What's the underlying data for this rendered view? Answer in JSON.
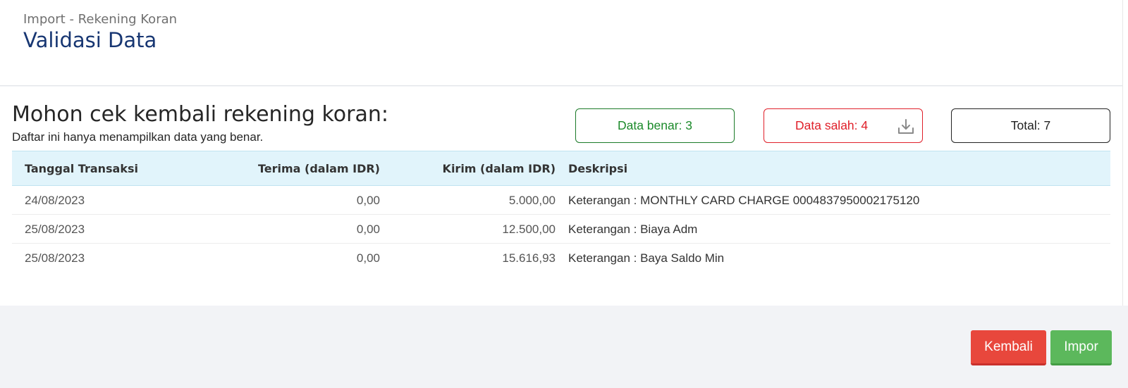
{
  "header": {
    "breadcrumb": "Import - Rekening Koran",
    "title": "Validasi Data"
  },
  "main": {
    "heading": "Mohon cek kembali rekening koran:",
    "subheading": "Daftar ini hanya menampilkan data yang benar.",
    "stats": {
      "benar": "Data benar: 3",
      "salah": "Data salah: 4",
      "total": "Total: 7"
    },
    "colors": {
      "benar": "#1b8a2a",
      "salah": "#e0202a",
      "header_bg": "#e1f4fb",
      "title": "#173672"
    },
    "icons": {
      "salah_action": "download-icon"
    },
    "table": {
      "columns": [
        "Tanggal Transaksi",
        "Terima (dalam IDR)",
        "Kirim (dalam IDR)",
        "Deskripsi"
      ],
      "rows": [
        [
          "24/08/2023",
          "0,00",
          "5.000,00",
          "Keterangan : MONTHLY CARD CHARGE 0004837950002175120"
        ],
        [
          "25/08/2023",
          "0,00",
          "12.500,00",
          "Keterangan : Biaya Adm"
        ],
        [
          "25/08/2023",
          "0,00",
          "15.616,93",
          "Keterangan : Baya Saldo Min"
        ]
      ]
    }
  },
  "actions": {
    "kembali_label": "Kembali",
    "impor_label": "Impor",
    "kembali_color": "#e8473c",
    "impor_color": "#5cb85c"
  }
}
